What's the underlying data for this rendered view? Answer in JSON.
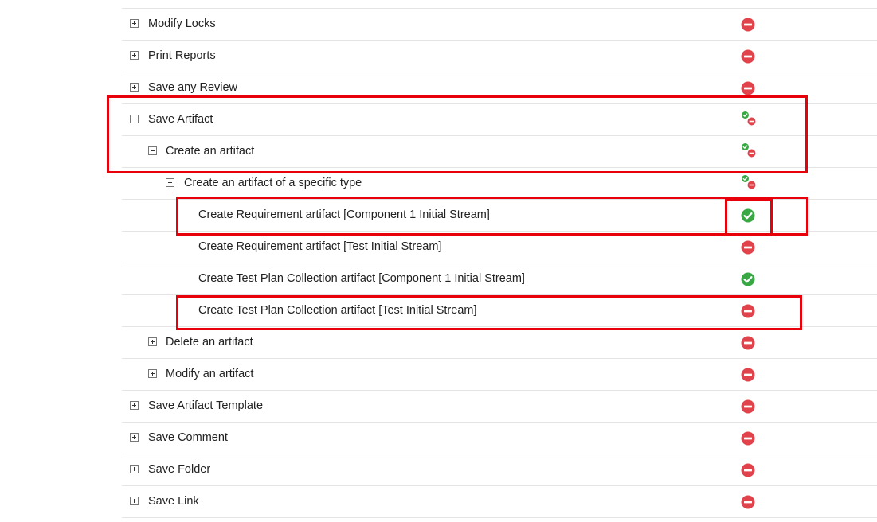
{
  "rows": [
    {
      "label": "Modify Locks",
      "toggle": "plus",
      "status": "deny",
      "level": 0
    },
    {
      "label": "Print Reports",
      "toggle": "plus",
      "status": "deny",
      "level": 0
    },
    {
      "label": "Save any Review",
      "toggle": "plus",
      "status": "deny",
      "level": 0
    },
    {
      "label": "Save Artifact",
      "toggle": "minus",
      "status": "mixed",
      "level": 0
    },
    {
      "label": "Create an artifact",
      "toggle": "minus",
      "status": "mixed",
      "level": 1
    },
    {
      "label": "Create an artifact of a specific type",
      "toggle": "minus",
      "status": "mixed",
      "level": 2
    },
    {
      "label": "Create Requirement artifact [Component 1 Initial Stream]",
      "toggle": "none",
      "status": "allow",
      "level": 3
    },
    {
      "label": "Create Requirement artifact [Test Initial Stream]",
      "toggle": "none",
      "status": "deny",
      "level": 3
    },
    {
      "label": "Create Test Plan Collection artifact [Component 1 Initial Stream]",
      "toggle": "none",
      "status": "allow",
      "level": 3
    },
    {
      "label": "Create Test Plan Collection artifact [Test Initial Stream]",
      "toggle": "none",
      "status": "deny",
      "level": 3
    },
    {
      "label": "Delete an artifact",
      "toggle": "plus",
      "status": "deny",
      "level": 1
    },
    {
      "label": "Modify an artifact",
      "toggle": "plus",
      "status": "deny",
      "level": 1
    },
    {
      "label": "Save Artifact Template",
      "toggle": "plus",
      "status": "deny",
      "level": 0
    },
    {
      "label": "Save Comment",
      "toggle": "plus",
      "status": "deny",
      "level": 0
    },
    {
      "label": "Save Folder",
      "toggle": "plus",
      "status": "deny",
      "level": 0
    },
    {
      "label": "Save Link",
      "toggle": "plus",
      "status": "deny",
      "level": 0
    }
  ],
  "colors": {
    "deny": "#e0434b",
    "allow": "#3aa745",
    "highlight": "#e8000b"
  },
  "icons": {
    "deny": "deny-icon",
    "allow": "allow-icon",
    "mixed": "mixed-permission-icon",
    "plus": "expand-icon",
    "minus": "collapse-icon"
  }
}
